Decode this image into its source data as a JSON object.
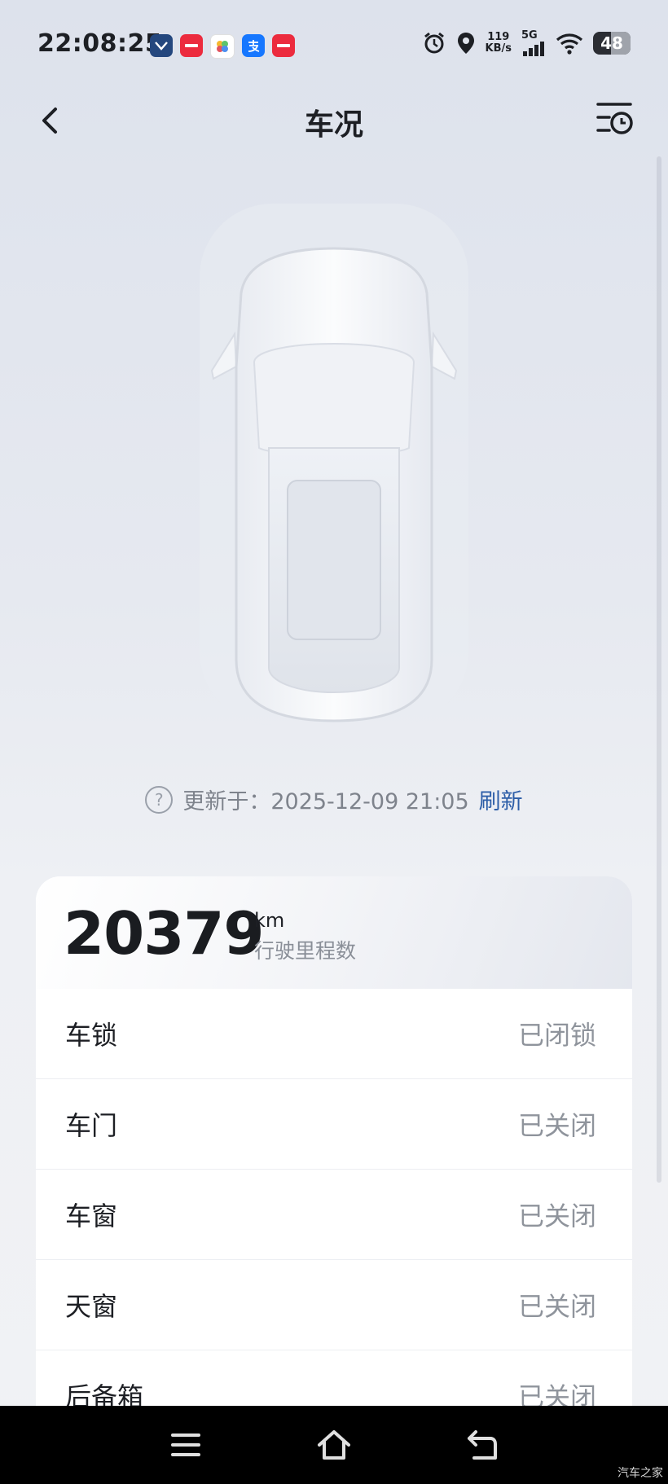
{
  "status_bar": {
    "time": "22:08:25",
    "net_speed_value": "119",
    "net_speed_unit": "KB/s",
    "network": "5G",
    "battery": "48",
    "battery_level_percent": 48
  },
  "header": {
    "title": "车况"
  },
  "update": {
    "text": "更新于：2025-12-09 21:05",
    "refresh_label": "刷新"
  },
  "mileage": {
    "value": "20379",
    "unit": "km",
    "label": "行驶里程数"
  },
  "status_items": [
    {
      "label": "车锁",
      "value": "已闭锁"
    },
    {
      "label": "车门",
      "value": "已关闭"
    },
    {
      "label": "车窗",
      "value": "已关闭"
    },
    {
      "label": "天窗",
      "value": "已关闭"
    },
    {
      "label": "后备箱",
      "value": "已关闭"
    }
  ],
  "watermark": "汽车之家",
  "colors": {
    "accent": "#2d5ea8",
    "muted": "#8f949c"
  }
}
